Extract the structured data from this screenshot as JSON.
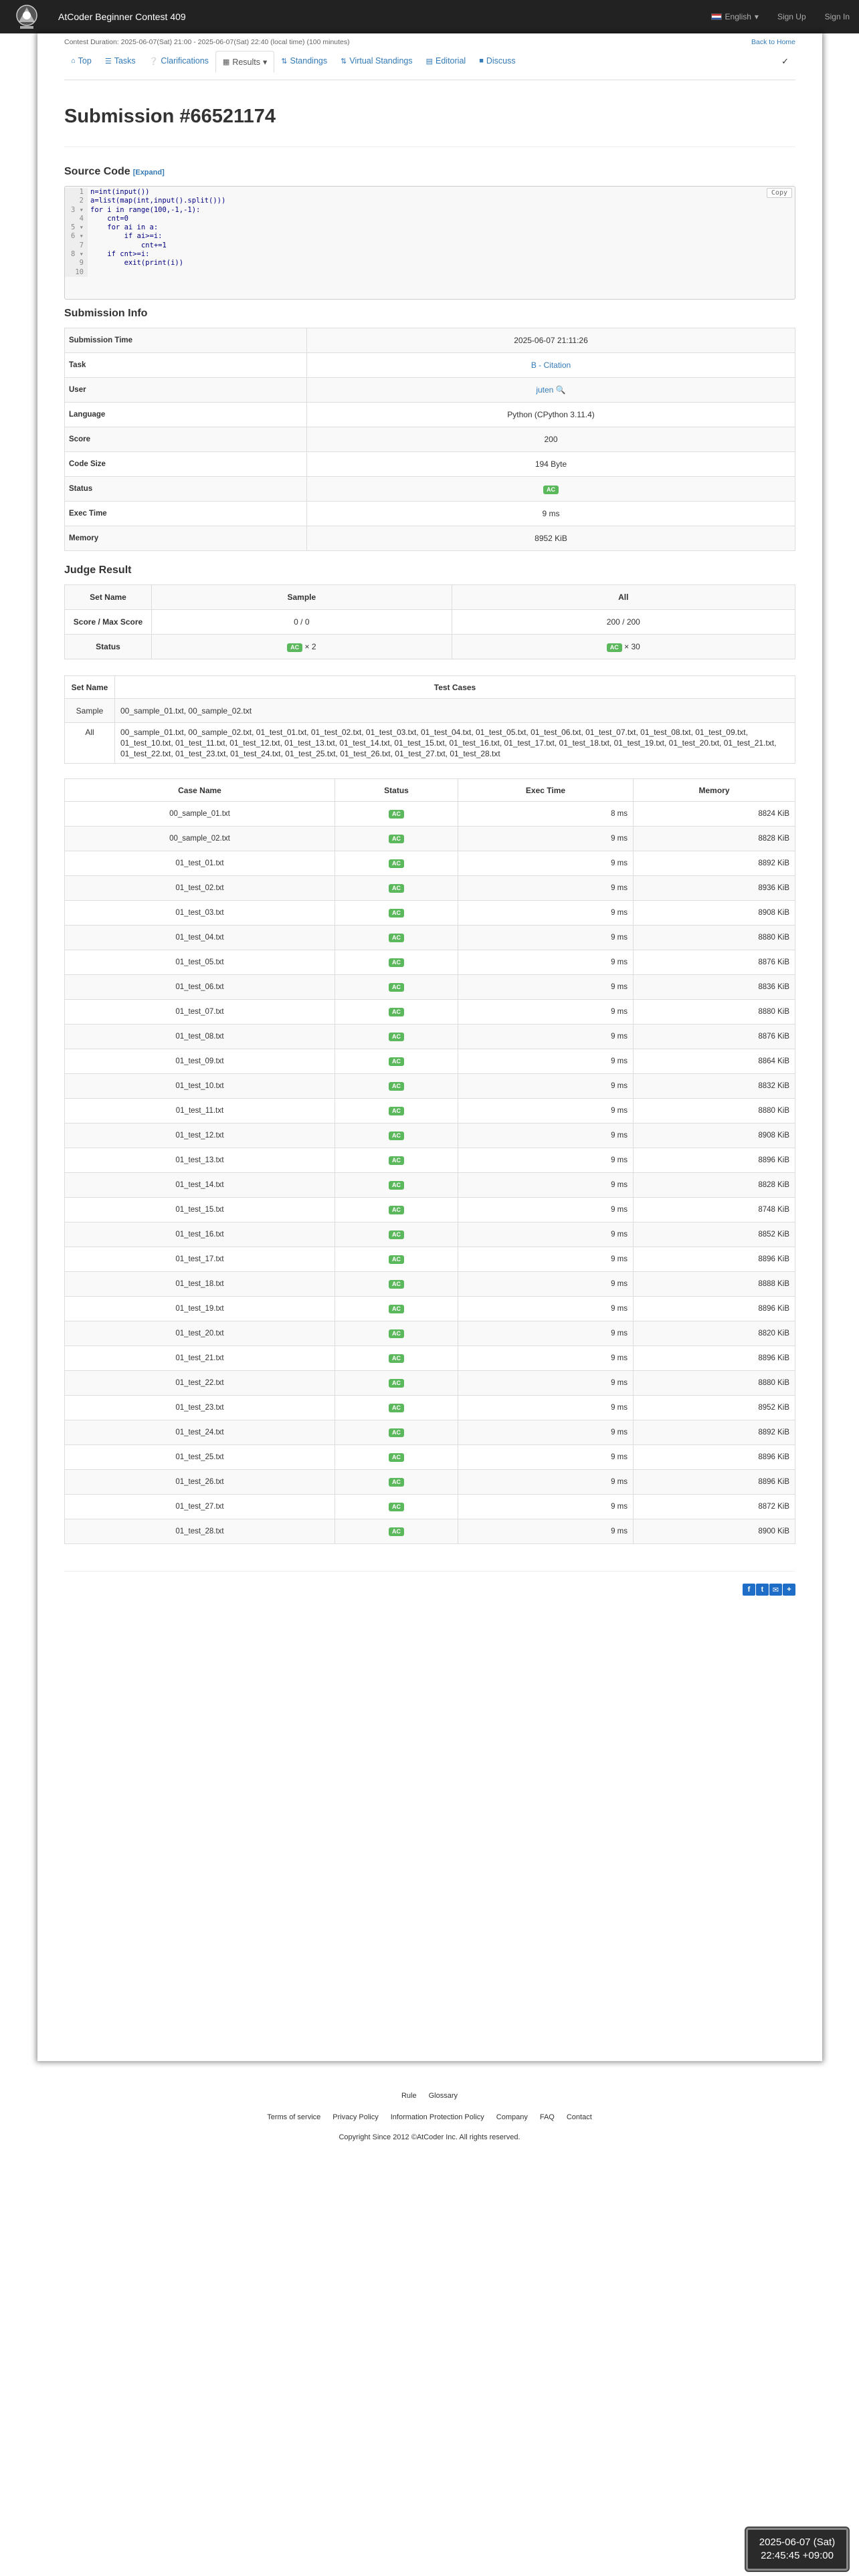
{
  "nav": {
    "brand": "AtCoder Beginner Contest 409",
    "language": "English",
    "sign_up": "Sign Up",
    "sign_in": "Sign In"
  },
  "contest": {
    "duration": "Contest Duration: 2025-06-07(Sat) 21:00 - 2025-06-07(Sat) 22:40 (local time) (100 minutes)",
    "back_to_home": "Back to Home"
  },
  "tabs": [
    {
      "label": "Top",
      "icon": "home-icon"
    },
    {
      "label": "Tasks",
      "icon": "list-icon"
    },
    {
      "label": "Clarifications",
      "icon": "question-icon"
    },
    {
      "label": "Results",
      "icon": "table-icon"
    },
    {
      "label": "Standings",
      "icon": "sort-icon"
    },
    {
      "label": "Virtual Standings",
      "icon": "sort-icon"
    },
    {
      "label": "Editorial",
      "icon": "book-icon"
    },
    {
      "label": "Discuss",
      "icon": "comment-icon"
    }
  ],
  "title": "Submission #66521174",
  "source_code": {
    "heading": "Source Code",
    "expand": "[Expand]",
    "copy": "Copy",
    "lines": [
      {
        "num": "1",
        "code": "n=int(input())"
      },
      {
        "num": "2",
        "code": "a=list(map(int,input().split()))"
      },
      {
        "num": "3 ▾",
        "code": "for i in range(100,-1,-1):"
      },
      {
        "num": "4",
        "code": "    cnt=0"
      },
      {
        "num": "5 ▾",
        "code": "    for ai in a:"
      },
      {
        "num": "6 ▾",
        "code": "        if ai>=i:"
      },
      {
        "num": "7",
        "code": "            cnt+=1"
      },
      {
        "num": "8 ▾",
        "code": "    if cnt>=i:"
      },
      {
        "num": "9",
        "code": "        exit(print(i))"
      },
      {
        "num": "10",
        "code": ""
      }
    ]
  },
  "submission_info": {
    "heading": "Submission Info",
    "rows": [
      {
        "key": "Submission Time",
        "value": "2025-06-07 21:11:26"
      },
      {
        "key": "Task",
        "value": "B - Citation"
      },
      {
        "key": "User",
        "value": "juten"
      },
      {
        "key": "Language",
        "value": "Python (CPython 3.11.4)"
      },
      {
        "key": "Score",
        "value": "200"
      },
      {
        "key": "Code Size",
        "value": "194 Byte"
      },
      {
        "key": "Status",
        "value": "AC"
      },
      {
        "key": "Exec Time",
        "value": "9 ms"
      },
      {
        "key": "Memory",
        "value": "8952 KiB"
      }
    ]
  },
  "judge_result": {
    "heading": "Judge Result",
    "headers": [
      "Set Name",
      "Sample",
      "All"
    ],
    "score_label": "Score / Max Score",
    "score_sample": "0 / 0",
    "score_all": "200 / 200",
    "status_label": "Status",
    "status_sample_badge": "AC",
    "status_sample_count": "× 2",
    "status_all_badge": "AC",
    "status_all_count": "× 30"
  },
  "test_cases": {
    "headers": [
      "Set Name",
      "Test Cases"
    ],
    "rows": [
      {
        "set": "Sample",
        "cases": "00_sample_01.txt, 00_sample_02.txt"
      },
      {
        "set": "All",
        "cases": "00_sample_01.txt, 00_sample_02.txt, 01_test_01.txt, 01_test_02.txt, 01_test_03.txt, 01_test_04.txt, 01_test_05.txt, 01_test_06.txt, 01_test_07.txt, 01_test_08.txt, 01_test_09.txt, 01_test_10.txt, 01_test_11.txt, 01_test_12.txt, 01_test_13.txt, 01_test_14.txt, 01_test_15.txt, 01_test_16.txt, 01_test_17.txt, 01_test_18.txt, 01_test_19.txt, 01_test_20.txt, 01_test_21.txt, 01_test_22.txt, 01_test_23.txt, 01_test_24.txt, 01_test_25.txt, 01_test_26.txt, 01_test_27.txt, 01_test_28.txt"
      }
    ]
  },
  "case_results": {
    "headers": [
      "Case Name",
      "Status",
      "Exec Time",
      "Memory"
    ],
    "rows": [
      {
        "name": "00_sample_01.txt",
        "status": "AC",
        "time": "8 ms",
        "memory": "8824 KiB"
      },
      {
        "name": "00_sample_02.txt",
        "status": "AC",
        "time": "9 ms",
        "memory": "8828 KiB"
      },
      {
        "name": "01_test_01.txt",
        "status": "AC",
        "time": "9 ms",
        "memory": "8892 KiB"
      },
      {
        "name": "01_test_02.txt",
        "status": "AC",
        "time": "9 ms",
        "memory": "8936 KiB"
      },
      {
        "name": "01_test_03.txt",
        "status": "AC",
        "time": "9 ms",
        "memory": "8908 KiB"
      },
      {
        "name": "01_test_04.txt",
        "status": "AC",
        "time": "9 ms",
        "memory": "8880 KiB"
      },
      {
        "name": "01_test_05.txt",
        "status": "AC",
        "time": "9 ms",
        "memory": "8876 KiB"
      },
      {
        "name": "01_test_06.txt",
        "status": "AC",
        "time": "9 ms",
        "memory": "8836 KiB"
      },
      {
        "name": "01_test_07.txt",
        "status": "AC",
        "time": "9 ms",
        "memory": "8880 KiB"
      },
      {
        "name": "01_test_08.txt",
        "status": "AC",
        "time": "9 ms",
        "memory": "8876 KiB"
      },
      {
        "name": "01_test_09.txt",
        "status": "AC",
        "time": "9 ms",
        "memory": "8864 KiB"
      },
      {
        "name": "01_test_10.txt",
        "status": "AC",
        "time": "9 ms",
        "memory": "8832 KiB"
      },
      {
        "name": "01_test_11.txt",
        "status": "AC",
        "time": "9 ms",
        "memory": "8880 KiB"
      },
      {
        "name": "01_test_12.txt",
        "status": "AC",
        "time": "9 ms",
        "memory": "8908 KiB"
      },
      {
        "name": "01_test_13.txt",
        "status": "AC",
        "time": "9 ms",
        "memory": "8896 KiB"
      },
      {
        "name": "01_test_14.txt",
        "status": "AC",
        "time": "9 ms",
        "memory": "8828 KiB"
      },
      {
        "name": "01_test_15.txt",
        "status": "AC",
        "time": "9 ms",
        "memory": "8748 KiB"
      },
      {
        "name": "01_test_16.txt",
        "status": "AC",
        "time": "9 ms",
        "memory": "8852 KiB"
      },
      {
        "name": "01_test_17.txt",
        "status": "AC",
        "time": "9 ms",
        "memory": "8896 KiB"
      },
      {
        "name": "01_test_18.txt",
        "status": "AC",
        "time": "9 ms",
        "memory": "8888 KiB"
      },
      {
        "name": "01_test_19.txt",
        "status": "AC",
        "time": "9 ms",
        "memory": "8896 KiB"
      },
      {
        "name": "01_test_20.txt",
        "status": "AC",
        "time": "9 ms",
        "memory": "8820 KiB"
      },
      {
        "name": "01_test_21.txt",
        "status": "AC",
        "time": "9 ms",
        "memory": "8896 KiB"
      },
      {
        "name": "01_test_22.txt",
        "status": "AC",
        "time": "9 ms",
        "memory": "8880 KiB"
      },
      {
        "name": "01_test_23.txt",
        "status": "AC",
        "time": "9 ms",
        "memory": "8952 KiB"
      },
      {
        "name": "01_test_24.txt",
        "status": "AC",
        "time": "9 ms",
        "memory": "8892 KiB"
      },
      {
        "name": "01_test_25.txt",
        "status": "AC",
        "time": "9 ms",
        "memory": "8896 KiB"
      },
      {
        "name": "01_test_26.txt",
        "status": "AC",
        "time": "9 ms",
        "memory": "8896 KiB"
      },
      {
        "name": "01_test_27.txt",
        "status": "AC",
        "time": "9 ms",
        "memory": "8872 KiB"
      },
      {
        "name": "01_test_28.txt",
        "status": "AC",
        "time": "9 ms",
        "memory": "8900 KiB"
      }
    ]
  },
  "footer": {
    "row1": [
      "Rule",
      "Glossary"
    ],
    "row2": [
      "Terms of service",
      "Privacy Policy",
      "Information Protection Policy",
      "Company",
      "FAQ",
      "Contact"
    ],
    "copyright": "Copyright Since 2012 ©AtCoder Inc. All rights reserved."
  },
  "clock": {
    "date": "2025-06-07 (Sat)",
    "time": "22:45:45 +09:00"
  },
  "colors": {
    "ac_badge": "#5cb85c",
    "link": "#337ab7",
    "navbar": "#222222"
  }
}
